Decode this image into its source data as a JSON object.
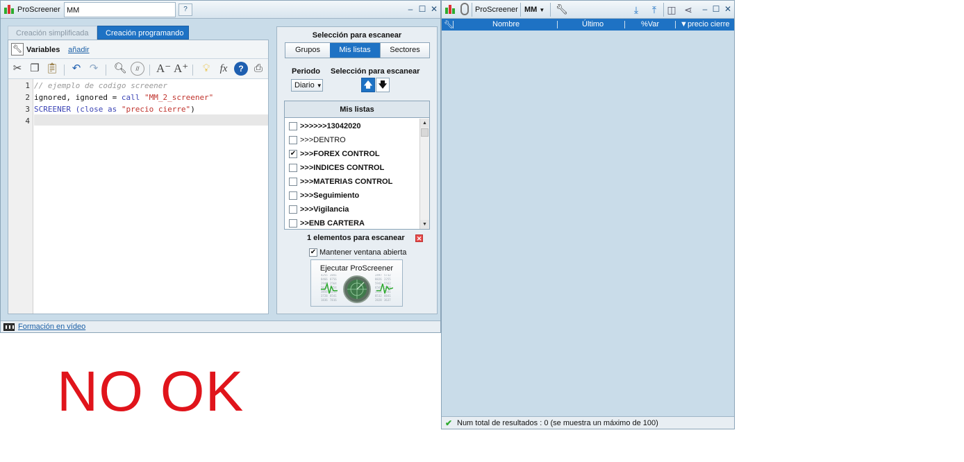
{
  "left_window": {
    "app_name": "ProScreener",
    "screener_name": "MM",
    "help_icon": "help-icon",
    "controls": {
      "minimize": "–",
      "maximize": "☐",
      "close": "✕"
    },
    "tabs": [
      {
        "label": "Creación simplificada",
        "active": false
      },
      {
        "label": "Creación programando",
        "active": true
      }
    ],
    "variables": {
      "label": "Variables",
      "add_link": "añadir"
    },
    "toolbar_icons": [
      "cut-icon",
      "copy-icon",
      "paste-icon",
      "undo-icon",
      "redo-icon",
      "search-icon",
      "comment-icon",
      "decrease-font-icon",
      "increase-font-icon",
      "lightbulb-icon",
      "function-icon",
      "help-icon",
      "print-icon"
    ],
    "code_lines": [
      {
        "n": "1",
        "text": "// ejemplo de codigo screener"
      },
      {
        "n": "2",
        "p1": "ignored, ignored = ",
        "kw": "call",
        "sp": " ",
        "str": "\"MM_2_screener\""
      },
      {
        "n": "3",
        "kw1": "SCREENER",
        "p1": " ",
        "kw2": "(close as",
        "p2": " ",
        "str": "\"precio cierre\"",
        "p3": ")"
      },
      {
        "n": "4"
      }
    ],
    "scan": {
      "title": "Selección para escanear",
      "segments": [
        {
          "label": "Grupos",
          "active": false
        },
        {
          "label": "Mis listas",
          "active": true
        },
        {
          "label": "Sectores",
          "active": false
        }
      ],
      "period_label": "Periodo",
      "selection_label": "Selección para escanear",
      "period_value": "Diario",
      "lists_title": "Mis listas",
      "lists": [
        {
          "label": ">>>>>>13042020",
          "checked": false,
          "bold": true
        },
        {
          "label": ">>>DENTRO",
          "checked": false,
          "bold": false
        },
        {
          "label": ">>>FOREX CONTROL",
          "checked": true,
          "bold": true
        },
        {
          "label": ">>>INDICES CONTROL",
          "checked": false,
          "bold": true
        },
        {
          "label": ">>>MATERIAS CONTROL",
          "checked": false,
          "bold": true
        },
        {
          "label": ">>>Seguimiento",
          "checked": false,
          "bold": true
        },
        {
          "label": ">>>Vigilancia",
          "checked": false,
          "bold": true
        },
        {
          "label": ">>ENB CARTERA",
          "checked": false,
          "bold": true
        }
      ],
      "count_text": "1 elementos para escanear",
      "keep_open_label": "Mantener ventana abierta",
      "keep_open_checked": true,
      "run_label": "Ejecutar ProScreener",
      "run_numbers_left": [
        "4255",
        "2841",
        "8466",
        "8756",
        "2946",
        "2564",
        "5626",
        "0854",
        "3856",
        "0256",
        "3728",
        "8541",
        "1836",
        "7816"
      ],
      "run_numbers_right": [
        "2497",
        "5732",
        "8826",
        "2255",
        "5941",
        "5562",
        "6565",
        "2558",
        "3326",
        "8541",
        "8532",
        "8841",
        "2828",
        "3637"
      ]
    },
    "footer_link": "Formación en vídeo"
  },
  "annotation": "NO OK",
  "right_window": {
    "app_name": "ProScreener",
    "screener_name": "MM",
    "columns": [
      {
        "label": "Nombre"
      },
      {
        "label": "Último"
      },
      {
        "label": "%Var"
      },
      {
        "label": "precio cierre"
      }
    ],
    "footer_text": "Num total de resultados : 0 (se muestra un máximo de 100)"
  }
}
